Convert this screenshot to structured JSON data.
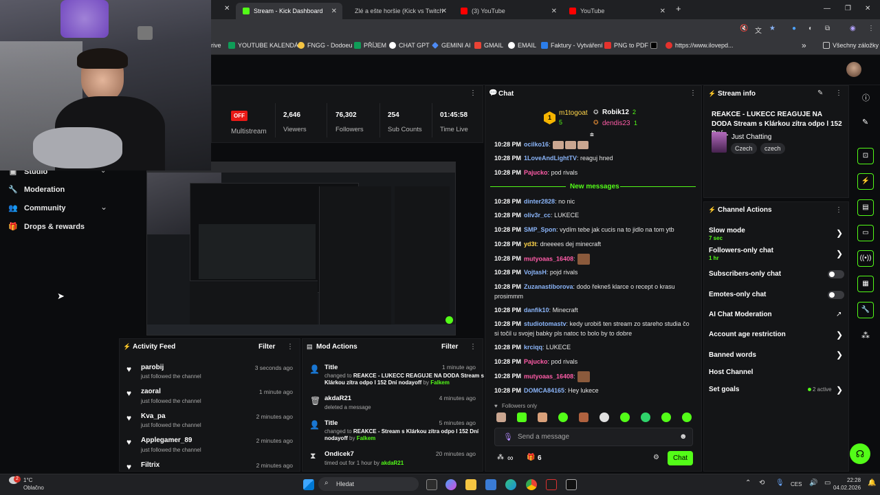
{
  "browser": {
    "tabs": [
      {
        "label": "Stream - Kick Dashboard",
        "active": true
      },
      {
        "label": "Zlé a ešte horšie (Kick vs Twitch",
        "active": false
      },
      {
        "label": "(3) YouTube",
        "active": false
      },
      {
        "label": "YouTube",
        "active": false
      }
    ],
    "new_tab": "+",
    "bookmarks": [
      {
        "label": "rive"
      },
      {
        "label": "YOUTUBE KALENDÁŘ"
      },
      {
        "label": "FNGG - Dodoeu"
      },
      {
        "label": "PŘÍJEM"
      },
      {
        "label": "CHAT GPT"
      },
      {
        "label": "GEMINI AI"
      },
      {
        "label": "GMAIL"
      },
      {
        "label": "EMAIL"
      },
      {
        "label": "Faktury - Vytváření"
      },
      {
        "label": "PNG to PDF"
      },
      {
        "label": "https://www.ilovepd..."
      }
    ],
    "bookmarks_overflow": "»",
    "all_bookmarks": "Všechny záložky"
  },
  "sidebar": {
    "items": [
      {
        "label": "Studio",
        "icon": "studio-icon"
      },
      {
        "label": "Moderation",
        "icon": "wrench-icon"
      },
      {
        "label": "Community",
        "icon": "people-icon"
      },
      {
        "label": "Drops & rewards",
        "icon": "gift-icon"
      }
    ]
  },
  "stats": {
    "status": "OFF",
    "multistream": "Multistream",
    "viewers_value": "2,646",
    "viewers_label": "Viewers",
    "followers_value": "76,302",
    "followers_label": "Followers",
    "subs_value": "254",
    "subs_label": "Sub Counts",
    "time_value": "01:45:58",
    "time_label": "Time Live"
  },
  "activity": {
    "title": "Activity Feed",
    "filter": "Filter",
    "items": [
      {
        "name": "parobij",
        "sub": "just followed the channel",
        "time": "3 seconds ago"
      },
      {
        "name": "zaoral",
        "sub": "just followed the channel",
        "time": "1 minute ago"
      },
      {
        "name": "Kva_pa",
        "sub": "just followed the channel",
        "time": "2 minutes ago"
      },
      {
        "name": "Applegamer_89",
        "sub": "just followed the channel",
        "time": "2 minutes ago"
      },
      {
        "name": "Filtrix",
        "sub": "",
        "time": "2 minutes ago"
      }
    ]
  },
  "mod": {
    "title": "Mod Actions",
    "filter": "Filter",
    "items": [
      {
        "title": "Title",
        "time": "1 minute ago",
        "pre": "changed to",
        "bold": "REAKCE - LUKECC REAGUJE NA DODA Stream s Klárkou zítra odpo l 152 Dní nodayoff",
        "by": "by",
        "user": "Falkem"
      },
      {
        "title": "akdaR21",
        "time": "4 minutes ago",
        "pre": "deleted a message",
        "bold": "",
        "by": "",
        "user": ""
      },
      {
        "title": "Title",
        "time": "5 minutes ago",
        "pre": "changed to",
        "bold": "REAKCE - Stream s Klárkou zítra odpo l 152 Dní nodayoff",
        "by": "by",
        "user": "Falkem"
      },
      {
        "title": "Ondicek7",
        "time": "20 minutes ago",
        "pre": "timed out for 1 hour",
        "bold": "",
        "by": "by",
        "user": "akdaR21"
      }
    ]
  },
  "chat": {
    "title": "Chat",
    "top": {
      "first": {
        "rank": "1",
        "name": "m1togoat",
        "count": "5"
      },
      "second": {
        "name": "Robik12",
        "count": "2"
      },
      "third": {
        "name": "dendis23",
        "count": "1"
      }
    },
    "messages": [
      {
        "time": "10:28 PM",
        "user": "ocilko16",
        "text": "",
        "color": "#8ab4f8"
      },
      {
        "time": "10:28 PM",
        "user": "1LoveAndLightTV",
        "text": "reaguj hned",
        "color": "#8ab4f8"
      },
      {
        "time": "10:28 PM",
        "user": "Pajucko",
        "text": "pod rivals",
        "color": "#ff5ca8"
      },
      {
        "time": "10:28 PM",
        "user": "dinter2828",
        "text": "no nic",
        "color": "#8ab4f8"
      },
      {
        "time": "10:28 PM",
        "user": "oliv3r_cc",
        "text": "LUKECE",
        "color": "#8ab4f8"
      },
      {
        "time": "10:28 PM",
        "user": "SMP_Spon",
        "text": "vydím tebe jak cucis na to jidlo na tom ytb",
        "color": "#8ab4f8"
      },
      {
        "time": "10:28 PM",
        "user": "yd3t",
        "text": "dneeees dej minecraft",
        "color": "#ffd54a"
      },
      {
        "time": "10:28 PM",
        "user": "mutyoaas_16408",
        "text": "",
        "color": "#ff5ca8"
      },
      {
        "time": "10:28 PM",
        "user": "VojtasH",
        "text": "pojd rivals",
        "color": "#8ab4f8"
      },
      {
        "time": "10:28 PM",
        "user": "Zuzanastiborova",
        "text": "dodo řekneš klarce o recept o krasu prosimmm",
        "color": "#8ab4f8"
      },
      {
        "time": "10:28 PM",
        "user": "danfik10",
        "text": "Minecraft",
        "color": "#8ab4f8"
      },
      {
        "time": "10:28 PM",
        "user": "studiotomastv",
        "text": "kedy urobiš ten stream zo stareho studia čo si točil u svojej babky pls natoc to bolo by to dobre",
        "color": "#8ab4f8"
      },
      {
        "time": "10:28 PM",
        "user": "krciqq",
        "text": "LUKECE",
        "color": "#8ab4f8"
      },
      {
        "time": "10:28 PM",
        "user": "Pajucko",
        "text": "pod rivals",
        "color": "#ff5ca8"
      },
      {
        "time": "10:28 PM",
        "user": "mutyoaas_16408",
        "text": "",
        "color": "#ff5ca8"
      },
      {
        "time": "10:28 PM",
        "user": "DOMCA84165",
        "text": "Hey lukece",
        "color": "#8ab4f8"
      }
    ],
    "new_messages": "New messages",
    "followers_only": "Followers only",
    "placeholder": "Send a message",
    "infinity": "∞",
    "gift_count": "6",
    "send": "Chat"
  },
  "stream_info": {
    "title": "Stream info",
    "stream_title": "REAKCE - LUKECC REAGUJE NA DODA Stream s Klárkou zítra odpo l 152 Dní...",
    "category": "Just Chatting",
    "tags": [
      "Czech",
      "czech"
    ]
  },
  "channel_actions": {
    "title": "Channel Actions",
    "slow_mode": "Slow mode",
    "slow_mode_value": "7 sec",
    "followers_only": "Followers-only chat",
    "followers_only_value": "1 hr",
    "subscribers_only": "Subscribers-only chat",
    "emotes_only": "Emotes-only chat",
    "ai_moderation": "AI Chat Moderation",
    "account_age": "Account age restriction",
    "banned_words": "Banned words",
    "host_channel": "Host Channel",
    "set_goals": "Set goals",
    "goals_active": "2 active"
  },
  "taskbar": {
    "weather_temp": "1°C",
    "weather_desc": "Oblačno",
    "weather_badge": "2",
    "search": "Hledat",
    "lang": "CES",
    "time": "22:28",
    "date": "04.02.2026"
  },
  "colors": {
    "accent": "#53fc18",
    "status_off": "#e91916"
  }
}
